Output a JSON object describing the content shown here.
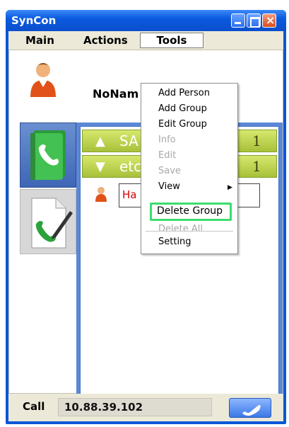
{
  "window": {
    "title": "SynCon"
  },
  "menubar": {
    "main": "Main",
    "actions": "Actions",
    "tools": "Tools"
  },
  "profile": {
    "name": "NoNam"
  },
  "groups": [
    {
      "name": "SA",
      "count": "1",
      "state": "collapsed"
    },
    {
      "name": "etc",
      "count": "1",
      "state": "expanded"
    }
  ],
  "contacts": [
    {
      "name": "Ha I"
    }
  ],
  "tools_menu": {
    "items": [
      {
        "label": "Add Person",
        "enabled": true
      },
      {
        "label": "Add Group",
        "enabled": true
      },
      {
        "label": "Edit Group",
        "enabled": true
      },
      {
        "label": "Info",
        "enabled": false
      },
      {
        "label": "Edit",
        "enabled": false
      },
      {
        "label": "Save",
        "enabled": false
      },
      {
        "label": "View",
        "enabled": true
      },
      {
        "label": "Delete Group",
        "enabled": true
      },
      {
        "label": "Delete All",
        "enabled": false
      },
      {
        "label": "Setting",
        "enabled": true
      }
    ]
  },
  "callbar": {
    "label": "Call",
    "value": "10.88.39.102"
  },
  "icons": {
    "nav_top": "phone-book-icon",
    "nav_bottom": "phone-document-icon",
    "call": "handset-icon"
  },
  "colors": {
    "titlebar": "#0a56d8",
    "group_row": "#a7c13a",
    "highlight": "#3ddc6e",
    "contact_name": "#d40000"
  }
}
